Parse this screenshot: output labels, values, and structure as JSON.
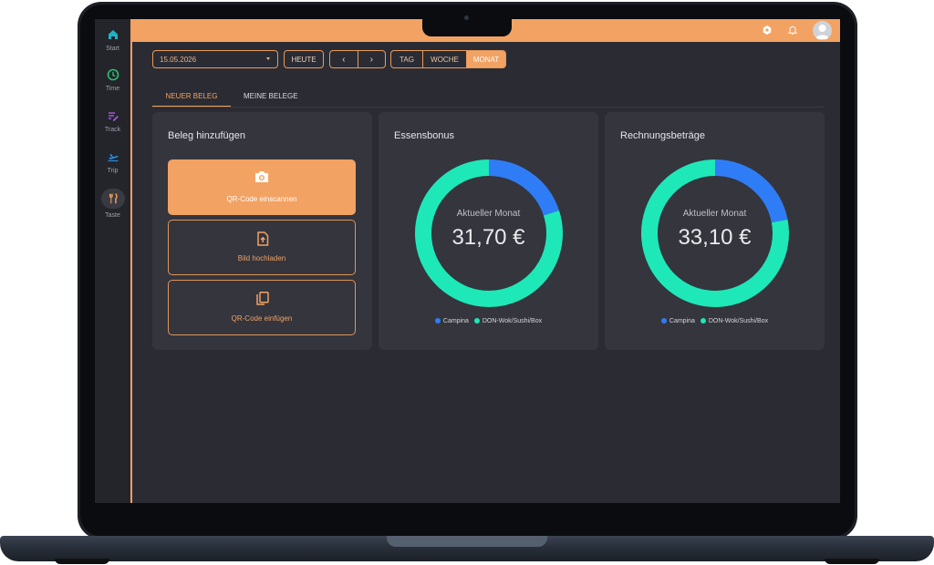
{
  "sidebar": {
    "items": [
      {
        "label": "Start",
        "icon": "home-icon",
        "color": "#1fb3c4"
      },
      {
        "label": "Time",
        "icon": "clock-icon",
        "color": "#2fbf71"
      },
      {
        "label": "Track",
        "icon": "edit-list-icon",
        "color": "#a05ad8"
      },
      {
        "label": "Trip",
        "icon": "plane-icon",
        "color": "#2f8de0"
      },
      {
        "label": "Taste",
        "icon": "fork-knife-icon",
        "color": "#f2a262"
      }
    ],
    "active": "Taste"
  },
  "topbar": {
    "accent": "#f2a262",
    "icons": [
      "settings-hex-icon",
      "bell-icon",
      "avatar"
    ]
  },
  "toolbar": {
    "date": "15.05.2026",
    "today": "HEUTE",
    "prev": "‹",
    "next": "›",
    "ranges": [
      "TAG",
      "WOCHE",
      "MONAT"
    ],
    "active_range": "MONAT"
  },
  "tabs": [
    {
      "label": "NEUER BELEG",
      "active": true
    },
    {
      "label": "MEINE BELEGE",
      "active": false
    }
  ],
  "upload_card": {
    "title": "Beleg hinzufügen",
    "buttons": [
      {
        "label": "QR-Code einscannen",
        "icon": "camera-icon"
      },
      {
        "label": "Bild hochladen",
        "icon": "file-upload-icon"
      },
      {
        "label": "QR-Code einfügen",
        "icon": "copy-icon"
      }
    ]
  },
  "charts": [
    {
      "title": "Essensbonus",
      "subtitle": "Aktueller Monat",
      "value": "31,70 €"
    },
    {
      "title": "Rechnungsbeträge",
      "subtitle": "Aktueller Monat",
      "value": "33,10 €"
    }
  ],
  "chart_data": [
    {
      "type": "pie",
      "title": "Essensbonus",
      "categories": [
        "Campina",
        "DON-Wok/Sushi/Box"
      ],
      "values": [
        0.2,
        0.8
      ],
      "colors": [
        "#2f7df6",
        "#1ee8b8"
      ],
      "legend": "bottom"
    },
    {
      "type": "pie",
      "title": "Rechnungsbeträge",
      "categories": [
        "Campina",
        "DON-Wok/Sushi/Box"
      ],
      "values": [
        0.22,
        0.78
      ],
      "colors": [
        "#2f7df6",
        "#1ee8b8"
      ],
      "legend": "bottom"
    }
  ]
}
